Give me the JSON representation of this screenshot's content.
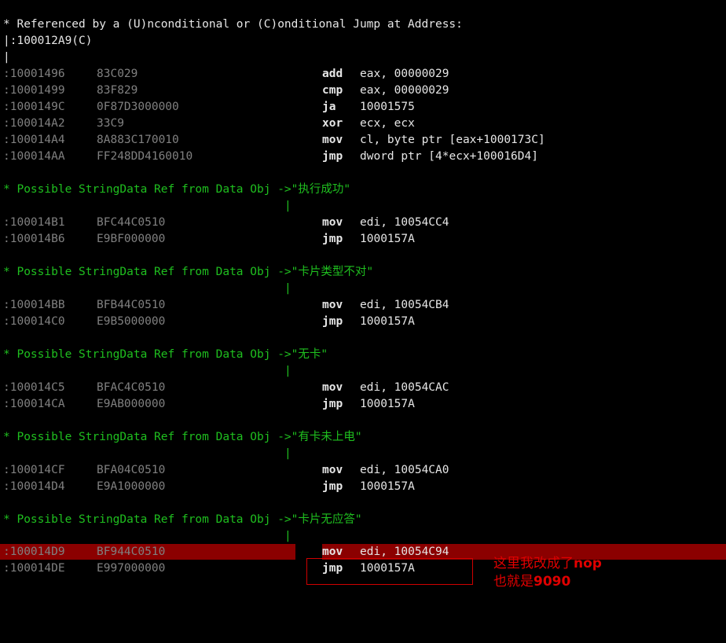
{
  "header": {
    "ref_line": "* Referenced by a (U)nconditional or (C)onditional Jump at Address:",
    "ref_addr": "|:100012A9(C)",
    "pipe": "|"
  },
  "block1": [
    {
      "addr": ":10001496",
      "hex": "83C029",
      "mnem": "add",
      "ops": "eax, 00000029"
    },
    {
      "addr": ":10001499",
      "hex": "83F829",
      "mnem": "cmp",
      "ops": "eax, 00000029"
    },
    {
      "addr": ":1000149C",
      "hex": "0F87D3000000",
      "mnem": "ja",
      "ops": "10001575"
    },
    {
      "addr": ":100014A2",
      "hex": "33C9",
      "mnem": "xor",
      "ops": "ecx, ecx"
    },
    {
      "addr": ":100014A4",
      "hex": "8A883C170010",
      "mnem": "mov",
      "ops": "cl, byte ptr [eax+1000173C]"
    },
    {
      "addr": ":100014AA",
      "hex": "FF248DD4160010",
      "mnem": "jmp",
      "ops": "dword ptr [4*ecx+100016D4]"
    }
  ],
  "refs": [
    {
      "text": "* Possible StringData Ref from Data Obj ->\"执行成功\"",
      "pipe": "|",
      "rows": [
        {
          "addr": ":100014B1",
          "hex": "BFC44C0510",
          "mnem": "mov",
          "ops": "edi, 10054CC4"
        },
        {
          "addr": ":100014B6",
          "hex": "E9BF000000",
          "mnem": "jmp",
          "ops": "1000157A"
        }
      ]
    },
    {
      "text": "* Possible StringData Ref from Data Obj ->\"卡片类型不对\"",
      "pipe": "|",
      "rows": [
        {
          "addr": ":100014BB",
          "hex": "BFB44C0510",
          "mnem": "mov",
          "ops": "edi, 10054CB4"
        },
        {
          "addr": ":100014C0",
          "hex": "E9B5000000",
          "mnem": "jmp",
          "ops": "1000157A"
        }
      ]
    },
    {
      "text": "* Possible StringData Ref from Data Obj ->\"无卡\"",
      "pipe": "|",
      "rows": [
        {
          "addr": ":100014C5",
          "hex": "BFAC4C0510",
          "mnem": "mov",
          "ops": "edi, 10054CAC"
        },
        {
          "addr": ":100014CA",
          "hex": "E9AB000000",
          "mnem": "jmp",
          "ops": "1000157A"
        }
      ]
    },
    {
      "text": "* Possible StringData Ref from Data Obj ->\"有卡未上电\"",
      "pipe": "|",
      "rows": [
        {
          "addr": ":100014CF",
          "hex": "BFA04C0510",
          "mnem": "mov",
          "ops": "edi, 10054CA0"
        },
        {
          "addr": ":100014D4",
          "hex": "E9A1000000",
          "mnem": "jmp",
          "ops": "1000157A"
        }
      ]
    },
    {
      "text": "* Possible StringData Ref from Data Obj ->\"卡片无应答\"",
      "pipe": "|",
      "rows": [
        {
          "addr": ":100014D9",
          "hex": "BF944C0510",
          "mnem": "mov",
          "ops": "edi, 10054C94"
        },
        {
          "addr": ":100014DE",
          "hex": "E997000000",
          "mnem": "jmp",
          "ops": "1000157A"
        }
      ]
    }
  ],
  "annotation": {
    "line1_prefix": "这里我改成了",
    "line1_bold": "nop",
    "line2_prefix": "也就是",
    "line2_bold": "9090"
  },
  "colors": {
    "background": "#000000",
    "green": "#1fbf1f",
    "highlight": "#8b0000",
    "annotation": "#e00000"
  }
}
